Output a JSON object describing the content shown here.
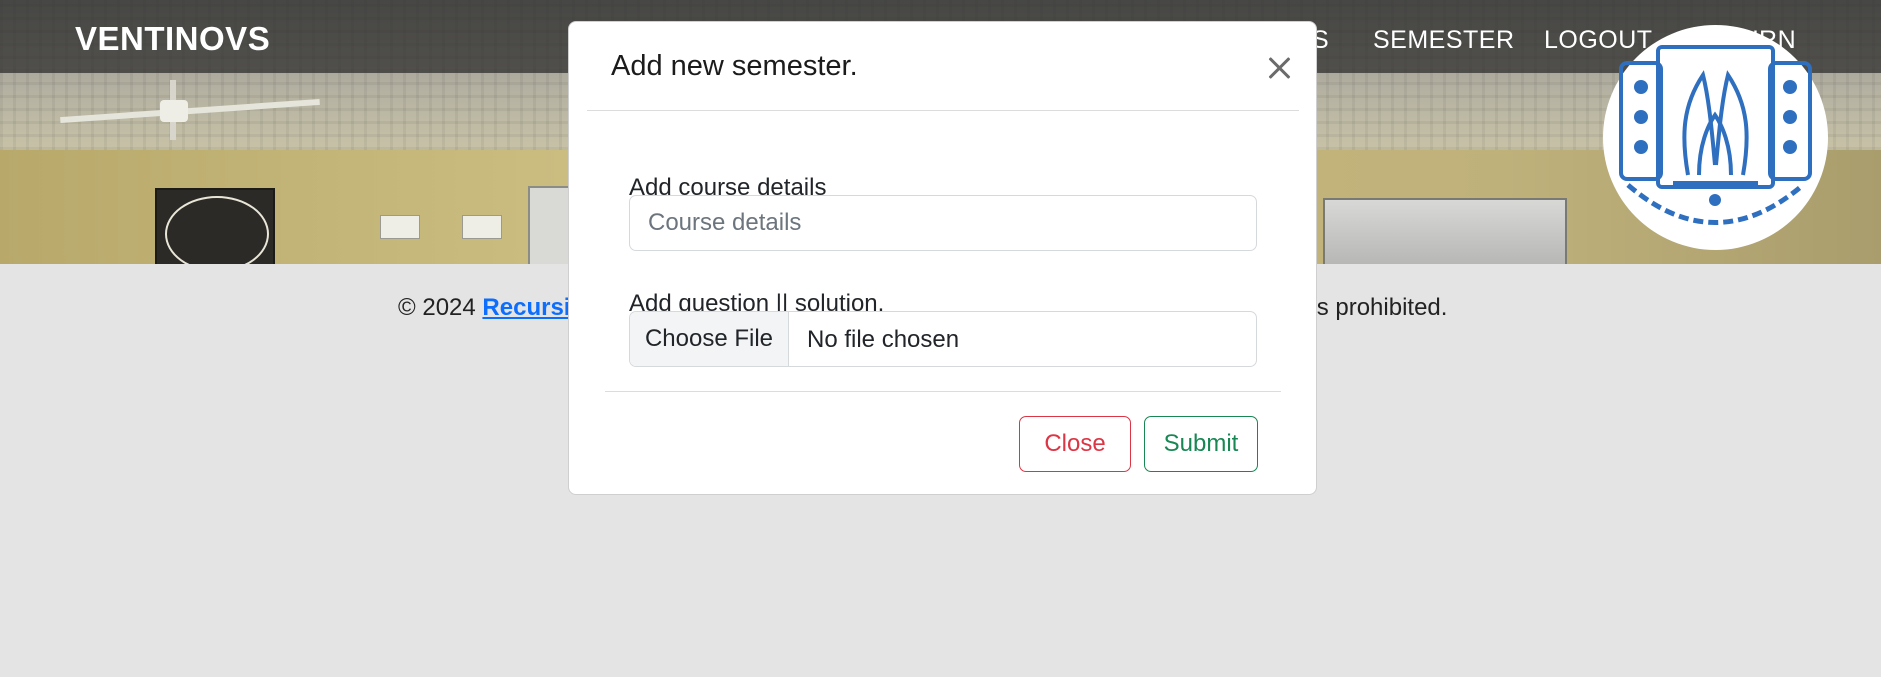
{
  "navbar": {
    "brand": "VENTINOVS",
    "links": [
      {
        "label": "S"
      },
      {
        "label": "SEMESTER"
      },
      {
        "label": "LOGOUT"
      },
      {
        "label": "RETURN"
      }
    ],
    "logo_icon": "university-seal-icon"
  },
  "footer": {
    "prefix": "© 2024 ",
    "link": "Recursi",
    "tail": "on is prohibited."
  },
  "modal": {
    "title": "Add new semester.",
    "close_icon": "close-icon",
    "course_label": "Add course details",
    "course_placeholder": "Course details",
    "course_value": "",
    "file_label": "Add question || solution.",
    "file_button": "Choose File",
    "file_status": "No file chosen",
    "close_button": "Close",
    "submit_button": "Submit"
  },
  "colors": {
    "danger": "#dc3545",
    "success": "#198754",
    "link": "#0d6efd",
    "seal_blue": "#2f6fbf"
  }
}
